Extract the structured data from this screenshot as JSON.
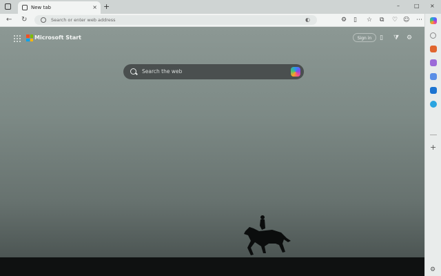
{
  "browser": {
    "tab_title": "New tab",
    "tab_close": "×",
    "new_tab": "+",
    "window_controls": [
      "–",
      "□",
      "×"
    ],
    "address_placeholder": "Search or enter web address",
    "nav": {
      "back": "←",
      "refresh": "↻"
    }
  },
  "page": {
    "brand": "Microsoft Start",
    "signin_label": "Sign in",
    "search_placeholder": "Search the web"
  },
  "colors": {
    "ms_red": "#f25022",
    "ms_green": "#7fba00",
    "ms_blue": "#00a4ef",
    "ms_yellow": "#ffb900"
  },
  "sidebar": {
    "icons": [
      "copilot-icon",
      "search-icon",
      "shopping-icon",
      "tools-icon",
      "games-icon",
      "outlook-icon",
      "drop-icon"
    ],
    "add": "+",
    "settings": "⚙"
  }
}
